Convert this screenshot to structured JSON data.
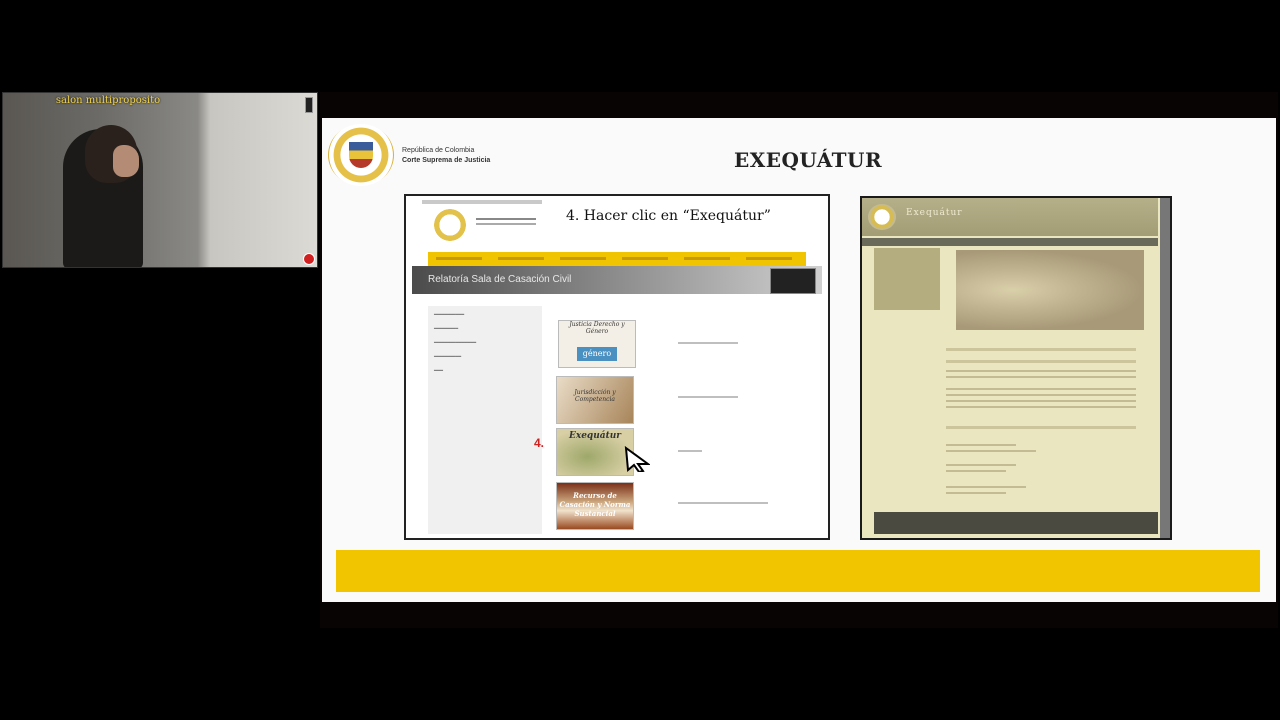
{
  "camera": {
    "room_label": "salon multiproposito"
  },
  "slide": {
    "org_line1": "República de Colombia",
    "org_line2": "Corte Suprema de Justicia",
    "title": "EXEQUÁTUR",
    "left_screenshot": {
      "step_text": "4.  Hacer clic en “Exequátur”",
      "banner": "Relatoría Sala de Casación Civil",
      "thumb1_title": "Justicia Derecho y Género",
      "thumb1_badge": "género",
      "thumb2_title": "Jurisdicción y Competencia",
      "thumb3_title": "Exequátur",
      "thumb4_title": "Recurso de Casación y Norma Sustancial",
      "step_number": "4."
    },
    "right_screenshot": {
      "site_name": "Exequátur"
    }
  },
  "colors": {
    "accent_yellow": "#f1c500",
    "step_red": "#d02020"
  },
  "icons": [
    "coat-of-arms-icon",
    "arrow-cursor-icon",
    "record-icon"
  ]
}
